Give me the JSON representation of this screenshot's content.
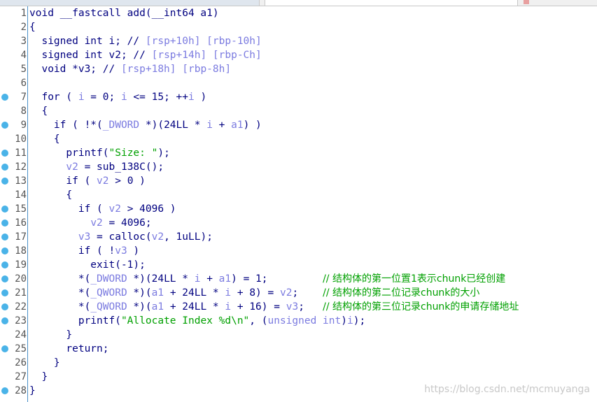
{
  "lines": [
    {
      "num": "1",
      "bp": false,
      "parts": [
        [
          "t",
          "void __fastcall add(__int64 a1)"
        ]
      ]
    },
    {
      "num": "2",
      "bp": false,
      "parts": [
        [
          "t",
          "{"
        ]
      ]
    },
    {
      "num": "3",
      "bp": false,
      "parts": [
        [
          "t",
          "  signed int i; // "
        ],
        [
          "v",
          "[rsp+10h] [rbp-10h]"
        ]
      ]
    },
    {
      "num": "4",
      "bp": false,
      "parts": [
        [
          "t",
          "  signed int v2; // "
        ],
        [
          "v",
          "[rsp+14h] [rbp-Ch]"
        ]
      ]
    },
    {
      "num": "5",
      "bp": false,
      "parts": [
        [
          "t",
          "  void *v3; // "
        ],
        [
          "v",
          "[rsp+18h] [rbp-8h]"
        ]
      ]
    },
    {
      "num": "6",
      "bp": false,
      "parts": []
    },
    {
      "num": "7",
      "bp": true,
      "parts": [
        [
          "t",
          "  for ( "
        ],
        [
          "v",
          "i"
        ],
        [
          "t",
          " = 0; "
        ],
        [
          "v",
          "i"
        ],
        [
          "t",
          " <= 15; ++"
        ],
        [
          "v",
          "i"
        ],
        [
          "t",
          " )"
        ]
      ]
    },
    {
      "num": "8",
      "bp": false,
      "parts": [
        [
          "t",
          "  {"
        ]
      ]
    },
    {
      "num": "9",
      "bp": true,
      "parts": [
        [
          "t",
          "    if ( !*("
        ],
        [
          "v",
          "_DWORD"
        ],
        [
          "t",
          " *)(24LL * "
        ],
        [
          "v",
          "i"
        ],
        [
          "t",
          " + "
        ],
        [
          "v",
          "a1"
        ],
        [
          "t",
          ") )"
        ]
      ]
    },
    {
      "num": "10",
      "bp": false,
      "parts": [
        [
          "t",
          "    {"
        ]
      ]
    },
    {
      "num": "11",
      "bp": true,
      "parts": [
        [
          "t",
          "      printf("
        ],
        [
          "s",
          "\"Size: \""
        ],
        [
          "t",
          ");"
        ]
      ]
    },
    {
      "num": "12",
      "bp": true,
      "parts": [
        [
          "t",
          "      "
        ],
        [
          "v",
          "v2"
        ],
        [
          "t",
          " = sub_138C();"
        ]
      ]
    },
    {
      "num": "13",
      "bp": true,
      "parts": [
        [
          "t",
          "      if ( "
        ],
        [
          "v",
          "v2"
        ],
        [
          "t",
          " > 0 )"
        ]
      ]
    },
    {
      "num": "14",
      "bp": false,
      "parts": [
        [
          "t",
          "      {"
        ]
      ]
    },
    {
      "num": "15",
      "bp": true,
      "parts": [
        [
          "t",
          "        if ( "
        ],
        [
          "v",
          "v2"
        ],
        [
          "t",
          " > 4096 )"
        ]
      ]
    },
    {
      "num": "16",
      "bp": true,
      "parts": [
        [
          "t",
          "          "
        ],
        [
          "v",
          "v2"
        ],
        [
          "t",
          " = 4096;"
        ]
      ]
    },
    {
      "num": "17",
      "bp": true,
      "parts": [
        [
          "t",
          "        "
        ],
        [
          "v",
          "v3"
        ],
        [
          "t",
          " = calloc("
        ],
        [
          "v",
          "v2"
        ],
        [
          "t",
          ", 1uLL);"
        ]
      ]
    },
    {
      "num": "18",
      "bp": true,
      "parts": [
        [
          "t",
          "        if ( !"
        ],
        [
          "v",
          "v3"
        ],
        [
          "t",
          " )"
        ]
      ]
    },
    {
      "num": "19",
      "bp": true,
      "parts": [
        [
          "t",
          "          exit(-1);"
        ]
      ]
    },
    {
      "num": "20",
      "bp": true,
      "parts": [
        [
          "t",
          "        *("
        ],
        [
          "v",
          "_DWORD"
        ],
        [
          "t",
          " *)(24LL * "
        ],
        [
          "v",
          "i"
        ],
        [
          "t",
          " + "
        ],
        [
          "v",
          "a1"
        ],
        [
          "t",
          ") = 1;         "
        ],
        [
          "c",
          "// 结构体的第一位置1表示chunk已经创建"
        ]
      ]
    },
    {
      "num": "21",
      "bp": true,
      "parts": [
        [
          "t",
          "        *("
        ],
        [
          "v",
          "_QWORD"
        ],
        [
          "t",
          " *)("
        ],
        [
          "v",
          "a1"
        ],
        [
          "t",
          " + 24LL * "
        ],
        [
          "v",
          "i"
        ],
        [
          "t",
          " + 8) = "
        ],
        [
          "v",
          "v2"
        ],
        [
          "t",
          ";    "
        ],
        [
          "c",
          "// 结构体的第二位记录chunk的大小"
        ]
      ]
    },
    {
      "num": "22",
      "bp": true,
      "parts": [
        [
          "t",
          "        *("
        ],
        [
          "v",
          "_QWORD"
        ],
        [
          "t",
          " *)("
        ],
        [
          "v",
          "a1"
        ],
        [
          "t",
          " + 24LL * "
        ],
        [
          "v",
          "i"
        ],
        [
          "t",
          " + 16) = "
        ],
        [
          "v",
          "v3"
        ],
        [
          "t",
          ";   "
        ],
        [
          "c",
          "// 结构体的第三位记录chunk的申请存储地址"
        ]
      ]
    },
    {
      "num": "23",
      "bp": true,
      "parts": [
        [
          "t",
          "        printf("
        ],
        [
          "s",
          "\"Allocate Index %d\\n\""
        ],
        [
          "t",
          ", ("
        ],
        [
          "v",
          "unsigned int"
        ],
        [
          "t",
          ")"
        ],
        [
          "v",
          "i"
        ],
        [
          "t",
          ");"
        ]
      ]
    },
    {
      "num": "24",
      "bp": false,
      "parts": [
        [
          "t",
          "      }"
        ]
      ]
    },
    {
      "num": "25",
      "bp": true,
      "parts": [
        [
          "t",
          "      return;"
        ]
      ]
    },
    {
      "num": "26",
      "bp": false,
      "parts": [
        [
          "t",
          "    }"
        ]
      ]
    },
    {
      "num": "27",
      "bp": false,
      "parts": [
        [
          "t",
          "  }"
        ]
      ]
    },
    {
      "num": "28",
      "bp": true,
      "parts": [
        [
          "t",
          "}"
        ]
      ]
    }
  ],
  "watermark": "https://blog.csdn.net/mcmuyanga",
  "colors": {
    "keyword": "#000080",
    "variable": "#7b7be0",
    "string": "#00a000",
    "comment": "#00a000",
    "breakpoint": "#4ab3e8"
  }
}
